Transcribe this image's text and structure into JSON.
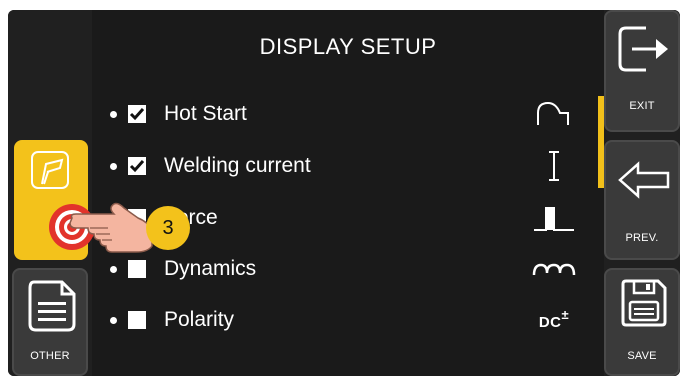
{
  "header": {
    "title": "DISPLAY SETUP"
  },
  "rows": [
    {
      "label": "Hot Start",
      "checked": true,
      "icon": "hot-start-curve-icon"
    },
    {
      "label": "Welding current",
      "checked": true,
      "icon": "current-i-icon"
    },
    {
      "label": "Force",
      "checked": false,
      "icon": "arc-force-icon"
    },
    {
      "label": "Dynamics",
      "checked": false,
      "icon": "inductance-coil-icon"
    },
    {
      "label": "Polarity",
      "checked": false,
      "icon": "dc-polarity-icon"
    }
  ],
  "polarity_icon_text": {
    "dc": "DC",
    "sign": "±"
  },
  "left_buttons": {
    "active_tool": {
      "icon": "flag-gun-icon"
    },
    "other": {
      "label": "OTHER"
    }
  },
  "right_buttons": {
    "exit": {
      "label": "EXIT"
    },
    "prev": {
      "label": "PREV."
    },
    "save": {
      "label": "SAVE"
    }
  },
  "tap_indicator": {
    "step": "3"
  },
  "colors": {
    "accent": "#f3c21b",
    "background": "#1a1a1a",
    "tile": "#3a3a3a",
    "target": "#e2332b"
  }
}
